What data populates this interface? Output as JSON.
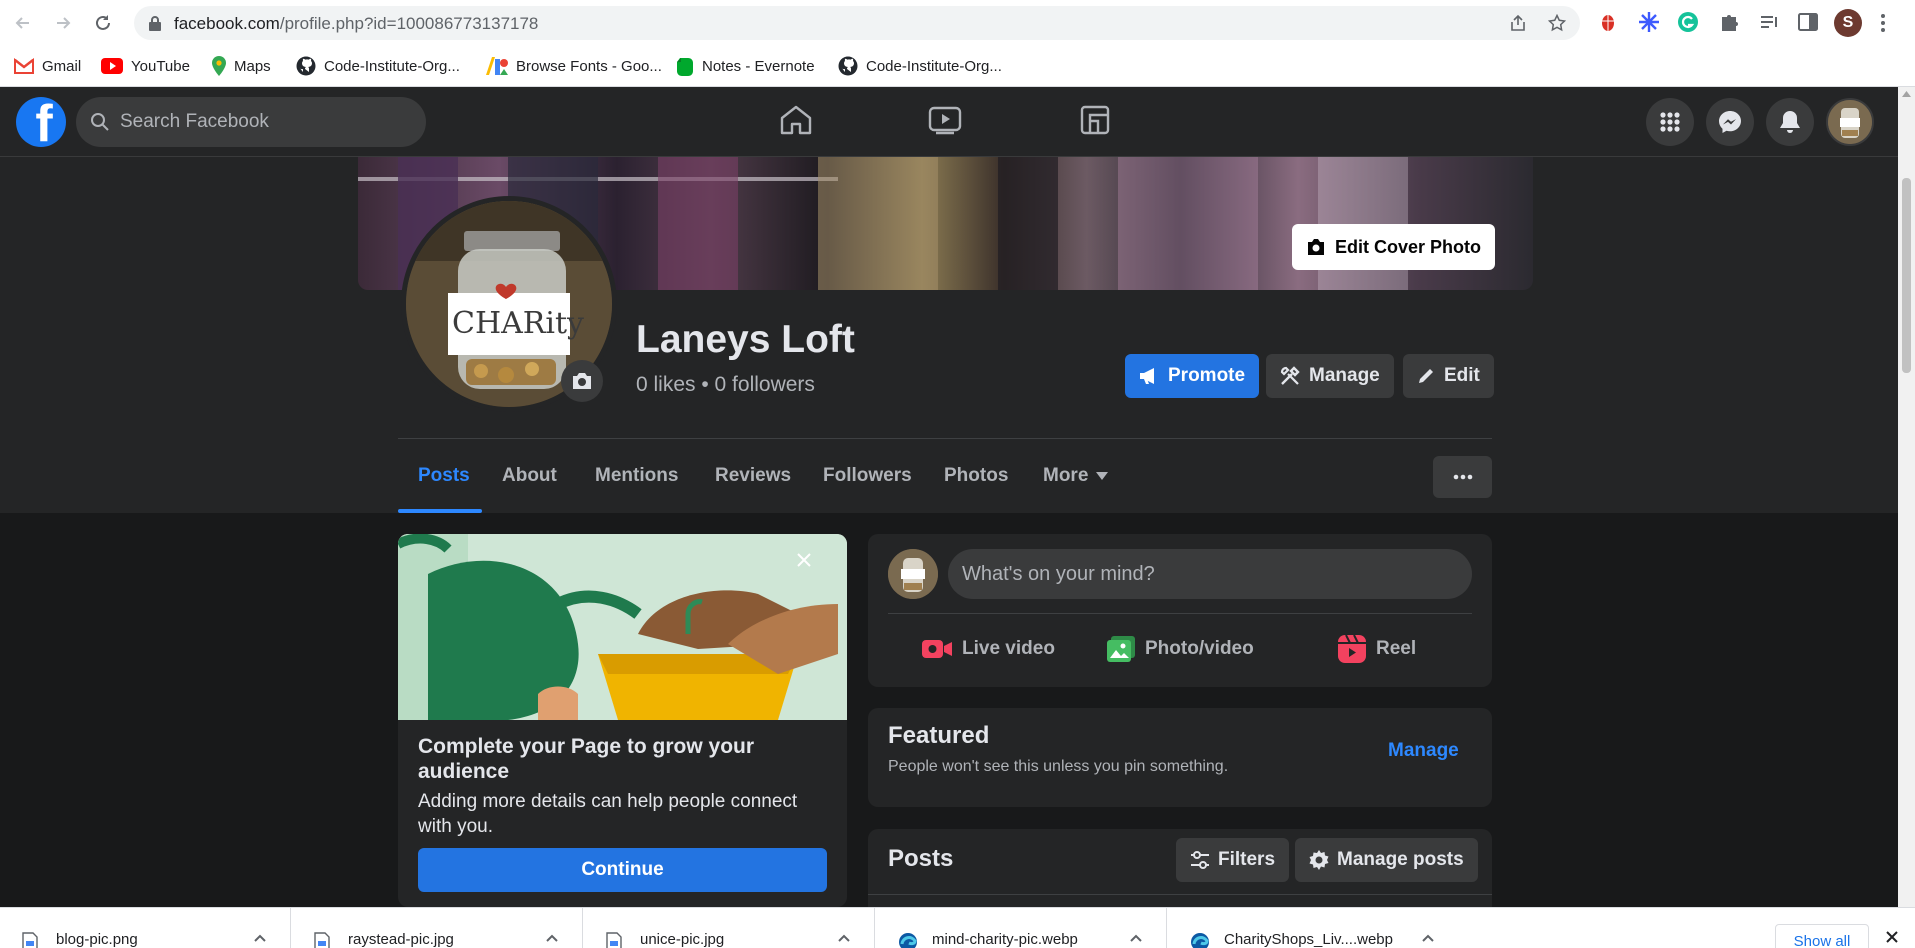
{
  "browser": {
    "url_host": "facebook.com",
    "url_path": "/profile.php?id=100086773137178",
    "profile_initial": "S",
    "bookmarks": [
      {
        "label": "Gmail",
        "icon": "gmail-icon"
      },
      {
        "label": "YouTube",
        "icon": "youtube-icon"
      },
      {
        "label": "Maps",
        "icon": "maps-icon"
      },
      {
        "label": "Code-Institute-Org...",
        "icon": "github-icon"
      },
      {
        "label": "Browse Fonts - Goo...",
        "icon": "google-fonts-icon"
      },
      {
        "label": "Notes - Evernote",
        "icon": "evernote-icon"
      },
      {
        "label": "Code-Institute-Org...",
        "icon": "github-icon"
      }
    ]
  },
  "fb_nav": {
    "logo": "f",
    "search_placeholder": "Search Facebook",
    "center_tabs": [
      "home-icon",
      "video-icon",
      "gaming-icon"
    ],
    "right_buttons": [
      "menu-grid-icon",
      "messenger-icon",
      "notifications-icon"
    ]
  },
  "profile": {
    "edit_cover_label": "Edit Cover Photo",
    "avatar_text": "CHARity",
    "name": "Laneys Loft",
    "stats": "0 likes • 0 followers",
    "buttons": {
      "promote": "Promote",
      "manage": "Manage",
      "edit": "Edit"
    },
    "tabs": [
      {
        "label": "Posts",
        "active": true
      },
      {
        "label": "About",
        "active": false
      },
      {
        "label": "Mentions",
        "active": false
      },
      {
        "label": "Reviews",
        "active": false
      },
      {
        "label": "Followers",
        "active": false
      },
      {
        "label": "Photos",
        "active": false
      },
      {
        "label": "More",
        "active": false
      }
    ]
  },
  "promo_card": {
    "title": "Complete your Page to grow your audience",
    "text": "Adding more details can help people connect with you.",
    "button": "Continue"
  },
  "composer": {
    "placeholder": "What's on your mind?",
    "actions": [
      {
        "label": "Live video",
        "icon": "live-video-icon",
        "color": "#f3425f"
      },
      {
        "label": "Photo/video",
        "icon": "photo-video-icon",
        "color": "#45bd62"
      },
      {
        "label": "Reel",
        "icon": "reel-icon",
        "color": "#f3425f"
      }
    ]
  },
  "featured": {
    "title": "Featured",
    "subtitle": "People won't see this unless you pin something.",
    "manage": "Manage"
  },
  "posts_section": {
    "title": "Posts",
    "filters": "Filters",
    "manage_posts": "Manage posts"
  },
  "downloads": {
    "items": [
      "blog-pic.png",
      "raystead-pic.jpg",
      "unice-pic.jpg",
      "mind-charity-pic.webp",
      "CharityShops_Liv....webp"
    ],
    "show_all": "Show all"
  },
  "colors": {
    "fb_blue": "#2374e1",
    "link_blue": "#2d88ff",
    "surface": "#242526",
    "background": "#18191a"
  }
}
